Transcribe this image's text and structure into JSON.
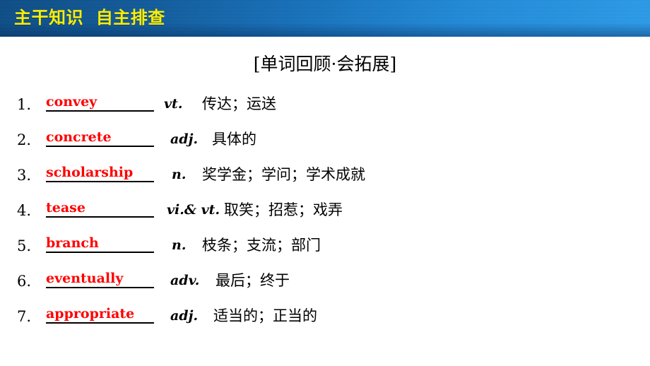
{
  "banner": {
    "title": "主干知识  自主排查",
    "text_color": "#ffee00",
    "gradient_from": "#0b4c86",
    "gradient_to": "#2a9ceb"
  },
  "section": {
    "heading": "[单词回顾·会拓展]"
  },
  "word_list": {
    "answer_color": "#ff0000",
    "items": [
      {
        "index": "1.",
        "word": "convey",
        "pos": "vt.",
        "meaning": "传达；运送"
      },
      {
        "index": "2.",
        "word": "concrete",
        "pos": "adj.",
        "meaning": "具体的"
      },
      {
        "index": "3.",
        "word": "scholarship",
        "pos": "n.",
        "meaning": "奖学金；学问；学术成就"
      },
      {
        "index": "4.",
        "word": "tease",
        "pos": "vi.& vt.",
        "meaning": "取笑；招惹；戏弄"
      },
      {
        "index": "5.",
        "word": "branch",
        "pos": "n.",
        "meaning": "枝条；支流；部门"
      },
      {
        "index": "6.",
        "word": "eventually",
        "pos": "adv.",
        "meaning": "最后；终于"
      },
      {
        "index": "7.",
        "word": "appropriate",
        "pos": "adj.",
        "meaning": "适当的；正当的"
      }
    ]
  }
}
